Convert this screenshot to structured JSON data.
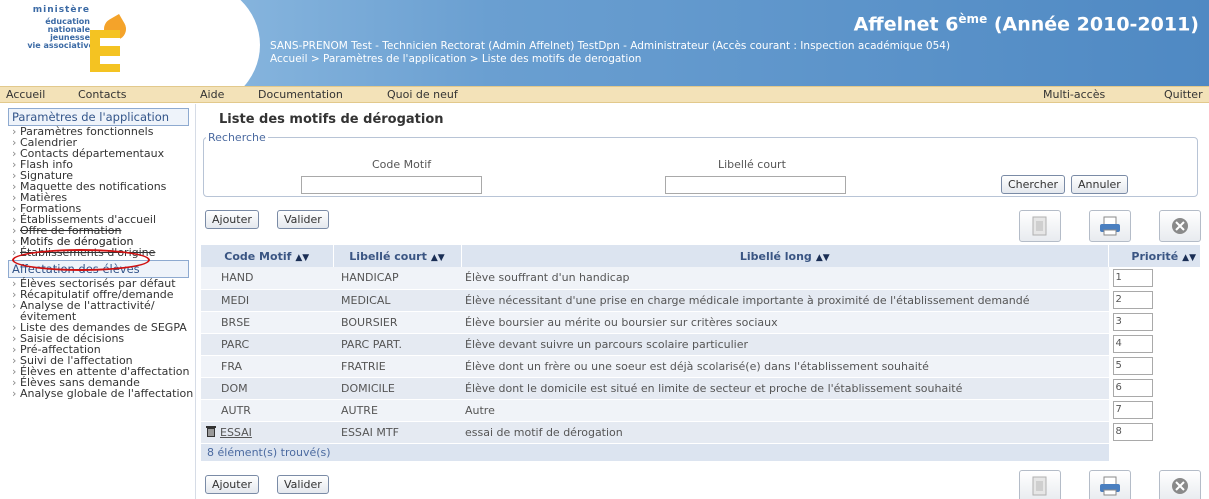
{
  "header": {
    "logo_lines": [
      "ministère",
      "éducation",
      "nationale",
      "jeunesse",
      "vie associative"
    ],
    "app_title_main": "Affelnet 6",
    "app_title_sup": "ème",
    "app_title_year": "(Année 2010-2011)",
    "user_line": "SANS-PRENOM Test - Technicien Rectorat (Admin Affelnet) TestDpn - Administrateur (Accès courant : Inspection académique 054)",
    "breadcrumb": "Accueil > Paramètres de l'application > Liste des motifs de derogation"
  },
  "menubar": {
    "accueil": "Accueil",
    "contacts": "Contacts",
    "aide": "Aide",
    "documentation": "Documentation",
    "quoi_de_neuf": "Quoi de neuf",
    "multi_acces": "Multi-accès",
    "quitter": "Quitter"
  },
  "sidebar": {
    "section1": "Paramètres de l'application",
    "items1": [
      "Paramètres fonctionnels",
      "Calendrier",
      "Contacts départementaux",
      "Flash info",
      "Signature",
      "Maquette des notifications",
      "Matières",
      "Formations",
      "Établissements d'accueil",
      "Offre de formation",
      "Motifs de dérogation",
      "Établissements d'origine"
    ],
    "section2": "Affectation des élèves",
    "items2": [
      "Élèves sectorisés par défaut",
      "Récapitulatif offre/demande",
      "Analyse de l'attractivité/évitement",
      "Liste des demandes de SEGPA",
      "Saisie de décisions",
      "Pré-affectation",
      "Suivi de l'affectation",
      "Élèves en attente d'affectation",
      "Élèves sans demande",
      "Analyse globale de l'affectation"
    ]
  },
  "main": {
    "title": "Liste des motifs de dérogation",
    "search": {
      "legend": "Recherche",
      "code_label": "Code Motif",
      "libelle_label": "Libellé court",
      "code_value": "",
      "libelle_value": "",
      "chercher": "Chercher",
      "annuler": "Annuler"
    },
    "ajouter": "Ajouter",
    "valider": "Valider",
    "sort_arrows": "▲▼",
    "columns": [
      "Code Motif",
      "Libellé court",
      "Libellé long",
      "Priorité"
    ],
    "rows": [
      {
        "code": "HAND",
        "court": "HANDICAP",
        "long": "Élève souffrant d'un handicap",
        "prio": "1"
      },
      {
        "code": "MEDI",
        "court": "MEDICAL",
        "long": "Élève nécessitant d'une prise en charge médicale importante à proximité de l'établissement demandé",
        "prio": "2"
      },
      {
        "code": "BRSE",
        "court": "BOURSIER",
        "long": "Élève boursier au mérite ou boursier sur critères sociaux",
        "prio": "3"
      },
      {
        "code": "PARC",
        "court": "PARC PART.",
        "long": "Élève devant suivre un parcours scolaire particulier",
        "prio": "4"
      },
      {
        "code": "FRA",
        "court": "FRATRIE",
        "long": "Élève dont un frère ou une soeur est déjà scolarisé(e) dans l'établissement souhaité",
        "prio": "5"
      },
      {
        "code": "DOM",
        "court": "DOMICILE",
        "long": "Élève dont le domicile est situé en limite de secteur et proche de l'établissement souhaité",
        "prio": "6"
      },
      {
        "code": "AUTR",
        "court": "AUTRE",
        "long": "Autre",
        "prio": "7"
      },
      {
        "code": "ESSAI",
        "court": "ESSAI MTF",
        "long": "essai de motif de dérogation",
        "prio": "8"
      }
    ],
    "footer": "8 élément(s) trouvé(s)"
  }
}
